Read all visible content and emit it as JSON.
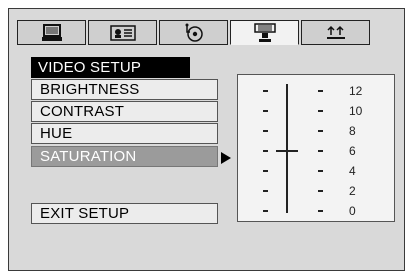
{
  "tabs": [
    {
      "icon": "monitor-icon",
      "active": false
    },
    {
      "icon": "language-card-icon",
      "active": false
    },
    {
      "icon": "audio-disc-icon",
      "active": false
    },
    {
      "icon": "video-camera-icon",
      "active": true
    },
    {
      "icon": "speaker-settings-icon",
      "active": false
    }
  ],
  "menu": {
    "title": "VIDEO SETUP",
    "items": [
      {
        "label": "BRIGHTNESS"
      },
      {
        "label": "CONTRAST"
      },
      {
        "label": "HUE"
      },
      {
        "label": "SATURATION"
      }
    ],
    "selected_index": 3,
    "exit_label": "EXIT SETUP"
  },
  "slider": {
    "ticks": [
      "12",
      "10",
      "8",
      "6",
      "4",
      "2",
      "0"
    ],
    "value": 6,
    "min": 0,
    "max": 12
  },
  "colors": {
    "selected_item_bg": "#9b9b9b",
    "title_bg": "#000000"
  }
}
